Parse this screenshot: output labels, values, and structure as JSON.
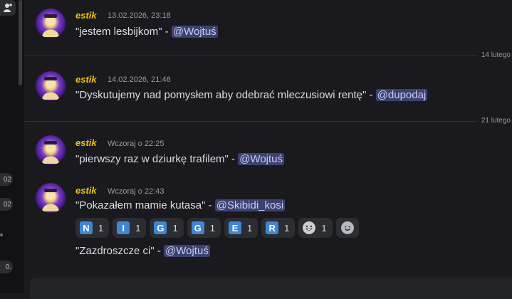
{
  "messages": [
    {
      "author": "estik",
      "time": "13.02.2026, 23:18",
      "text": "\"jestem lesbijkom\" -",
      "mention": "@Wojtuś"
    },
    {
      "author": "estik",
      "time": "14.02.2026, 21:46",
      "text": "\"Dyskutujemy nad pomysłem aby odebrać mleczusiowi rentę\" -",
      "mention": "@dupodaj"
    },
    {
      "author": "estik",
      "time": "Wczoraj o 22:25",
      "text": "\"pierwszy raz w dziurkę trafilem\" -",
      "mention": "@Wojtuś"
    },
    {
      "author": "estik",
      "time": "Wczoraj o 22:43",
      "text": "\"Pokazałem mamie kutasa\" -",
      "mention": "@Skibidi_kosi"
    }
  ],
  "followup": {
    "text": "\"Zazdroszcze ci\" -",
    "mention": "@Wojtuś"
  },
  "dividers": [
    "14 lutego",
    "21 lutego"
  ],
  "reactions": [
    {
      "emoji": "N",
      "count": "1"
    },
    {
      "emoji": "I",
      "count": "1"
    },
    {
      "emoji": "G",
      "count": "1"
    },
    {
      "emoji": "G",
      "count": "1"
    },
    {
      "emoji": "E",
      "count": "1"
    },
    {
      "emoji": "R",
      "count": "1"
    },
    {
      "emoji": "grin-face",
      "count": "1"
    }
  ],
  "rail": {
    "badges": [
      "02",
      "02",
      "0."
    ]
  },
  "colors": {
    "author": "#f0c419",
    "mention_bg": "#3c4270",
    "reaction_letter": "#3d87d6"
  }
}
